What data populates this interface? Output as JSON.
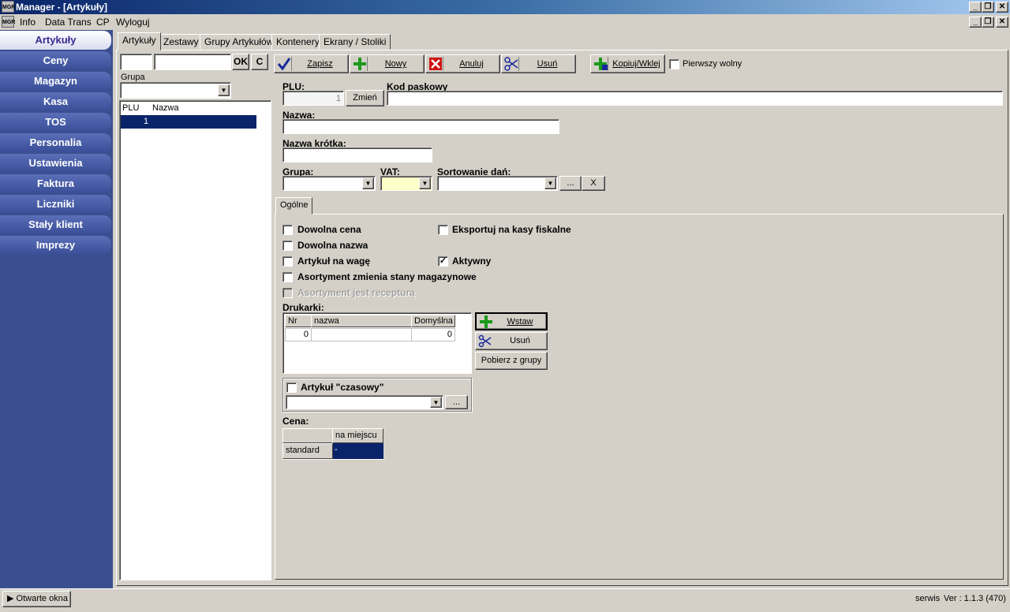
{
  "window": {
    "app_icon_text": "MGR",
    "title": "Manager - [Artykuły]"
  },
  "menu": {
    "items": [
      "Info",
      "Data Trans",
      "CP",
      "Wyloguj"
    ]
  },
  "nav": {
    "items": [
      "Artykuły",
      "Ceny",
      "Magazyn",
      "Kasa",
      "TOS",
      "Personalia",
      "Ustawienia",
      "Faktura",
      "Liczniki",
      "Stały klient",
      "Imprezy"
    ],
    "active": "Artykuły"
  },
  "tabs": [
    "Artykuły",
    "Zestawy",
    "Grupy Artykułów",
    "Kontenery",
    "Ekrany / Stoliki"
  ],
  "left_panel": {
    "search1_value": "",
    "search2_value": "",
    "ok_label": "OK",
    "c_label": "C",
    "group_label": "Grupa",
    "group_value": "",
    "list_headers": [
      "PLU",
      "Nazwa"
    ],
    "rows": [
      {
        "plu": "1",
        "name": ""
      }
    ]
  },
  "toolbar": {
    "save": "Zapisz",
    "new": "Nowy",
    "cancel": "Anuluj",
    "delete": "Usuń",
    "copy_paste": "Kopiuj/Wklej",
    "first_free": "Pierwszy wolny",
    "first_free_checked": false
  },
  "form": {
    "plu_label": "PLU:",
    "plu_value": "1",
    "change_label": "Zmień",
    "barcode_label": "Kod paskowy",
    "barcode_value": "",
    "name_label": "Nazwa:",
    "name_value": "",
    "short_name_label": "Nazwa krótka:",
    "short_name_value": "",
    "group_label": "Grupa:",
    "vat_label": "VAT:",
    "sort_label": "Sortowanie dań:",
    "dots_label": "...",
    "x_label": "X"
  },
  "subtab": "Ogólne",
  "options": {
    "free_price": "Dowolna cena",
    "free_name": "Dowolna nazwa",
    "weighed": "Artykuł na wagę",
    "assortment_stock": "Asortyment zmienia stany magazynowe",
    "assortment_recipe": "Asortyment jest recepturą",
    "export_fiscal": "Eksportuj na kasy fiskalne",
    "active": "Aktywny",
    "active_checked": true
  },
  "printers": {
    "label": "Drukarki:",
    "headers": [
      "Nr",
      "nazwa",
      "Domyślna"
    ],
    "rows": [
      {
        "nr": "0",
        "name": "",
        "default": "0"
      }
    ],
    "insert": "Wstaw",
    "delete": "Usuń",
    "fetch_group": "Pobierz z grupy"
  },
  "timed": {
    "label": "Artykuł \"czasowy\"",
    "dots": "..."
  },
  "price": {
    "label": "Cena:",
    "col_header": "na miejscu",
    "row_label": "standard",
    "value": "-"
  },
  "status": {
    "open_windows": "Otwarte okna",
    "user": "serwis",
    "version": "Ver : 1.1.3 (470)"
  }
}
